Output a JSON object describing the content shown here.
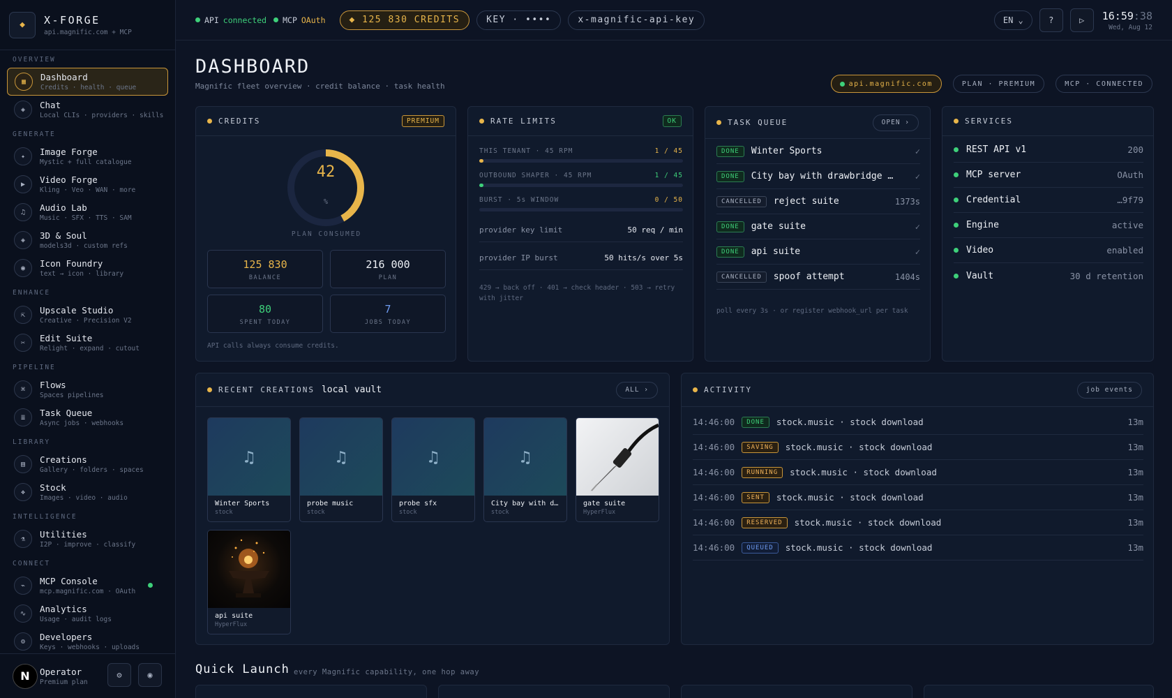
{
  "brand": {
    "title": "X-FORGE",
    "subtitle": "api.magnific.com + MCP",
    "icon": "diamond-icon"
  },
  "sidebar": {
    "sections": [
      "OVERVIEW",
      "GENERATE",
      "ENHANCE",
      "PIPELINE",
      "LIBRARY",
      "INTELLIGENCE",
      "CONNECT"
    ],
    "items": [
      {
        "label": "Dashboard",
        "sub": "Credits · health · queue",
        "icon": "grid-icon",
        "glyph": "▦"
      },
      {
        "label": "Chat",
        "sub": "Local CLIs · providers · skills",
        "icon": "chat-icon",
        "glyph": "◈"
      },
      {
        "label": "Image Forge",
        "sub": "Mystic + full catalogue",
        "icon": "sparkle-icon",
        "glyph": "✦"
      },
      {
        "label": "Video Forge",
        "sub": "Kling · Veo · WAN · more",
        "icon": "play-icon",
        "glyph": "▶"
      },
      {
        "label": "Audio Lab",
        "sub": "Music · SFX · TTS · SAM",
        "icon": "music-icon",
        "glyph": "♫"
      },
      {
        "label": "3D & Soul",
        "sub": "models3d · custom refs",
        "icon": "cube-icon",
        "glyph": "◈"
      },
      {
        "label": "Icon Foundry",
        "sub": "text → icon · library",
        "icon": "target-icon",
        "glyph": "◉"
      },
      {
        "label": "Upscale Studio",
        "sub": "Creative · Precision V2",
        "icon": "expand-icon",
        "glyph": "⇱"
      },
      {
        "label": "Edit Suite",
        "sub": "Relight · expand · cutout",
        "icon": "scissors-icon",
        "glyph": "✂"
      },
      {
        "label": "Flows",
        "sub": "Spaces pipelines",
        "icon": "flow-icon",
        "glyph": "⌘"
      },
      {
        "label": "Task Queue",
        "sub": "Async jobs · webhooks",
        "icon": "list-icon",
        "glyph": "≣"
      },
      {
        "label": "Creations",
        "sub": "Gallery · folders · spaces",
        "icon": "gallery-icon",
        "glyph": "▤"
      },
      {
        "label": "Stock",
        "sub": "Images · video · audio",
        "icon": "stock-icon",
        "glyph": "❖"
      },
      {
        "label": "Utilities",
        "sub": "I2P · improve · classify",
        "icon": "flask-icon",
        "glyph": "⚗"
      },
      {
        "label": "MCP Console",
        "sub": "mcp.magnific.com · OAuth",
        "icon": "terminal-icon",
        "glyph": "⌁"
      },
      {
        "label": "Analytics",
        "sub": "Usage · audit logs",
        "icon": "chart-icon",
        "glyph": "∿"
      },
      {
        "label": "Developers",
        "sub": "Keys · webhooks · uploads",
        "icon": "gear-icon",
        "glyph": "⚙"
      }
    ],
    "operator": {
      "initial": "N",
      "name": "Operator",
      "plan": "Premium plan"
    }
  },
  "topbar": {
    "api_label": "API",
    "api_value": "connected",
    "mcp_label": "MCP",
    "mcp_value": "OAuth",
    "credits": "◆ 125 830 CREDITS",
    "key": "KEY · ••••",
    "header_name": "x-magnific-api-key",
    "lang": "EN ⌄",
    "help": "?",
    "run": "▷",
    "time_hm": "16:59",
    "time_s": ":38",
    "date": "Wed, Aug 12"
  },
  "page": {
    "title": "DASHBOARD",
    "subtitle": "Magnific fleet overview · credit balance · task health",
    "pills": [
      "api.magnific.com",
      "PLAN · PREMIUM",
      "MCP · CONNECTED"
    ]
  },
  "credits": {
    "title": "CREDITS",
    "badge": "PREMIUM",
    "percent": 42,
    "percent_label": "42",
    "percent_unit": "%",
    "consumed_label": "PLAN CONSUMED",
    "stats": [
      {
        "value": "125 830",
        "label": "BALANCE",
        "color": "#e8b54a"
      },
      {
        "value": "216 000",
        "label": "PLAN",
        "color": "#eef1f6"
      },
      {
        "value": "80",
        "label": "SPENT TODAY",
        "color": "#3ed07a"
      },
      {
        "value": "7",
        "label": "JOBS TODAY",
        "color": "#6f9cf2"
      }
    ],
    "note": "API calls always consume credits."
  },
  "rate_limits": {
    "title": "RATE LIMITS",
    "badge": "OK",
    "bars": [
      {
        "label": "THIS TENANT · 45 RPM",
        "value": "1 / 45",
        "fraction": 0.022,
        "color": "#e8b54a"
      },
      {
        "label": "OUTBOUND SHAPER · 45 RPM",
        "value": "1 / 45",
        "fraction": 0.022,
        "color": "#3ed07a"
      },
      {
        "label": "BURST · 5s WINDOW",
        "value": "0 / 50",
        "fraction": 0,
        "color": "#e8b54a"
      }
    ],
    "kv": [
      {
        "k": "provider key limit",
        "v": "50 req / min"
      },
      {
        "k": "provider IP burst",
        "v": "50 hits/s over 5s"
      }
    ],
    "note": "429 → back off · 401 → check header · 503 → retry with jitter"
  },
  "task_queue": {
    "title": "TASK QUEUE",
    "button": "OPEN ›",
    "rows": [
      {
        "status": "DONE",
        "name": "Winter Sports",
        "right": "✓"
      },
      {
        "status": "DONE",
        "name": "City bay with drawbridge ca…",
        "right": "✓"
      },
      {
        "status": "CANCELLED",
        "name": "reject suite",
        "right": "1373s"
      },
      {
        "status": "DONE",
        "name": "gate suite",
        "right": "✓"
      },
      {
        "status": "DONE",
        "name": "api suite",
        "right": "✓"
      },
      {
        "status": "CANCELLED",
        "name": "spoof attempt",
        "right": "1404s"
      }
    ],
    "note": "poll every 3s · or register webhook_url per task"
  },
  "services": {
    "title": "SERVICES",
    "rows": [
      {
        "name": "REST API v1",
        "value": "200"
      },
      {
        "name": "MCP server",
        "value": "OAuth"
      },
      {
        "name": "Credential",
        "value": "…9f79"
      },
      {
        "name": "Engine",
        "value": "active"
      },
      {
        "name": "Video",
        "value": "enabled"
      },
      {
        "name": "Vault",
        "value": "30 d retention"
      }
    ]
  },
  "recent": {
    "title": "RECENT CREATIONS",
    "subtitle": "local vault",
    "button": "ALL ›",
    "tiles": [
      {
        "title": "Winter Sports",
        "source": "stock",
        "kind": "audio",
        "glyph": "♫"
      },
      {
        "title": "probe music",
        "source": "stock",
        "kind": "audio",
        "glyph": "♫"
      },
      {
        "title": "probe sfx",
        "source": "stock",
        "kind": "audio",
        "glyph": "♫"
      },
      {
        "title": "City bay with dr…",
        "source": "stock",
        "kind": "audio",
        "glyph": "♫"
      },
      {
        "title": "gate suite",
        "source": "HyperFlux",
        "kind": "image-cable"
      },
      {
        "title": "api suite",
        "source": "HyperFlux",
        "kind": "image-anvil"
      }
    ]
  },
  "activity": {
    "title": "ACTIVITY",
    "button": "job events",
    "rows": [
      {
        "time": "14:46:00",
        "status": "DONE",
        "text": "stock.music · stock download",
        "ago": "13m"
      },
      {
        "time": "14:46:00",
        "status": "SAVING",
        "text": "stock.music · stock download",
        "ago": "13m"
      },
      {
        "time": "14:46:00",
        "status": "RUNNING",
        "text": "stock.music · stock download",
        "ago": "13m"
      },
      {
        "time": "14:46:00",
        "status": "SENT",
        "text": "stock.music · stock download",
        "ago": "13m"
      },
      {
        "time": "14:46:00",
        "status": "RESERVED",
        "text": "stock.music · stock download",
        "ago": "13m"
      },
      {
        "time": "14:46:00",
        "status": "QUEUED",
        "text": "stock.music · stock download",
        "ago": "13m"
      }
    ]
  },
  "quick_launch": {
    "title": "Quick Launch",
    "subtitle": "every Magnific capability, one hop away"
  }
}
